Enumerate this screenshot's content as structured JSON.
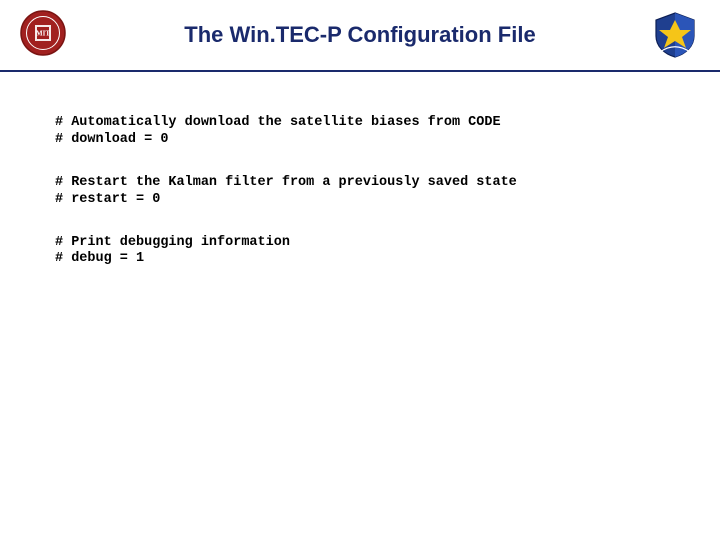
{
  "header": {
    "title": "The Win.TEC-P Configuration File"
  },
  "blocks": [
    {
      "line1": "# Automatically download the satellite biases from CODE",
      "line2": "# download = 0"
    },
    {
      "line1": "# Restart the Kalman filter from a previously saved state",
      "line2": "# restart = 0"
    },
    {
      "line1": "# Print debugging information",
      "line2": "# debug = 1"
    }
  ]
}
